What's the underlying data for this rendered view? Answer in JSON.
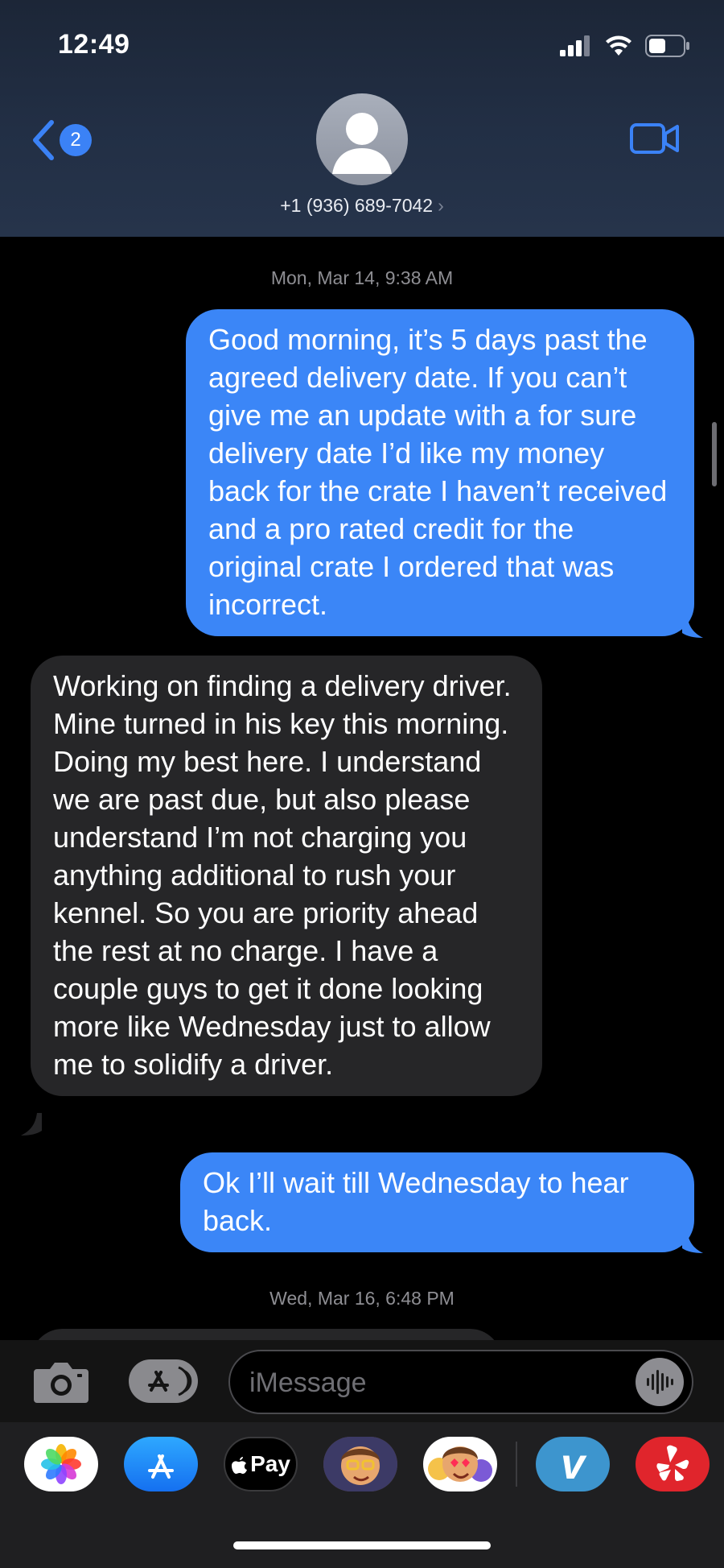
{
  "status_bar": {
    "time": "12:49"
  },
  "header": {
    "back_count": "2",
    "contact_name": "+1 (936) 689-7042",
    "contact_chevron": "›",
    "icons": [
      "chevron-left-icon",
      "person-icon",
      "video-camera-icon"
    ]
  },
  "conversation": {
    "timestamp_1": "Mon, Mar 14, 9:38 AM",
    "messages": [
      {
        "from": "me",
        "text": "Good morning, it’s 5 days past the agreed delivery date. If you can’t give me an update with a for sure delivery date I’d like my money back for the crate I haven’t received and a pro rated credit for the original crate I ordered that was incorrect."
      },
      {
        "from": "contact",
        "text": "Working on finding a delivery driver. Mine turned in his key this morning. Doing my best here. I understand we are past due, but also please understand I’m not charging you anything additional to rush your kennel. So you are priority ahead the rest at no charge. I have a couple guys to get it done looking more like Wednesday just to allow me to solidify a driver."
      },
      {
        "from": "me",
        "text": "Ok I’ll wait till Wednesday to hear back."
      }
    ],
    "timestamp_2": "Wed, Mar 16, 6:48 PM"
  },
  "input_bar": {
    "placeholder": "iMessage"
  },
  "app_strip": {
    "apple_pay_label": "Pay",
    "venmo_label": "v",
    "apps": [
      "photos-app-icon",
      "app-store-icon",
      "apple-pay-icon",
      "memoji-icon",
      "memoji-stickers-icon",
      "venmo-icon",
      "yelp-icon"
    ]
  },
  "colors": {
    "sent_bubble": "#3b86f7",
    "received_bubble": "#262628",
    "accent": "#3b82f6"
  }
}
